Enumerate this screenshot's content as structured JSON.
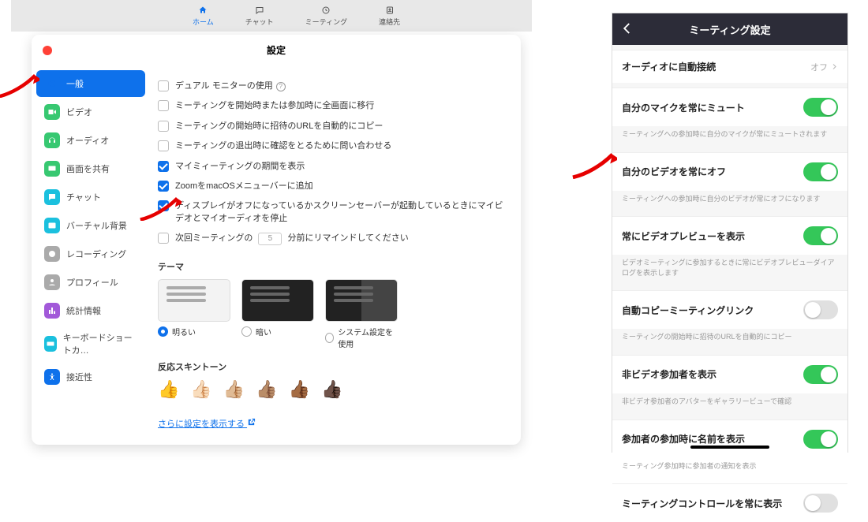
{
  "topTabs": [
    {
      "key": "home",
      "label": "ホーム",
      "active": true
    },
    {
      "key": "chat",
      "label": "チャット",
      "active": false
    },
    {
      "key": "meeting",
      "label": "ミーティング",
      "active": false
    },
    {
      "key": "contacts",
      "label": "連絡先",
      "active": false
    }
  ],
  "window": {
    "title": "設定"
  },
  "sidebar": [
    {
      "key": "general",
      "label": "一般",
      "icon": "gear",
      "color": "#0e71eb",
      "active": true
    },
    {
      "key": "video",
      "label": "ビデオ",
      "icon": "video",
      "color": "#37c871"
    },
    {
      "key": "audio",
      "label": "オーディオ",
      "icon": "headset",
      "color": "#37c871"
    },
    {
      "key": "share",
      "label": "画面を共有",
      "icon": "share",
      "color": "#37c871"
    },
    {
      "key": "chat",
      "label": "チャット",
      "icon": "chat",
      "color": "#1bc0de"
    },
    {
      "key": "vbg",
      "label": "バーチャル背景",
      "icon": "bg",
      "color": "#1bc0de"
    },
    {
      "key": "recording",
      "label": "レコーディング",
      "icon": "rec",
      "color": "#aaa"
    },
    {
      "key": "profile",
      "label": "プロフィール",
      "icon": "profile",
      "color": "#aaa"
    },
    {
      "key": "stats",
      "label": "統計情報",
      "icon": "stats",
      "color": "#a259d9"
    },
    {
      "key": "shortcut",
      "label": "キーボードショートカ…",
      "icon": "kb",
      "color": "#1bc0de"
    },
    {
      "key": "access",
      "label": "接近性",
      "icon": "access",
      "color": "#0e71eb"
    }
  ],
  "options": [
    {
      "label": "デュアル モニターの使用",
      "checked": false,
      "help": true
    },
    {
      "label": "ミーティングを開始時または参加時に全画面に移行",
      "checked": false
    },
    {
      "label": "ミーティングの開始時に招待のURLを自動的にコピー",
      "checked": false
    },
    {
      "label": "ミーティングの退出時に確認をとるために問い合わせる",
      "checked": false
    },
    {
      "label": "マイミィーティングの期間を表示",
      "checked": true
    },
    {
      "label": "ZoomをmacOSメニューバーに追加",
      "checked": true
    },
    {
      "label": "ディスプレイがオフになっているかスクリーンセーバーが起動しているときにマイビデオとマイオーディオを停止",
      "checked": true
    }
  ],
  "remind": {
    "prefix": "次回ミーティングの",
    "value": "5",
    "suffix": "分前にリマインドしてください",
    "checked": false
  },
  "themeHeading": "テーマ",
  "themes": [
    {
      "key": "light",
      "label": "明るい",
      "selected": true
    },
    {
      "key": "dark",
      "label": "暗い",
      "selected": false
    },
    {
      "key": "system",
      "label": "システム設定を使用",
      "selected": false
    }
  ],
  "skinHeading": "反応スキントーン",
  "skins": [
    "👍",
    "👍🏻",
    "👍🏼",
    "👍🏽",
    "👍🏾",
    "👍🏿"
  ],
  "moreLink": "さらに設定を表示する",
  "phone": {
    "title": "ミーティング設定",
    "rows": [
      {
        "key": "audio_connect",
        "label": "オーディオに自動接続",
        "type": "value",
        "value": "オフ"
      },
      {
        "key": "mic_mute",
        "label": "自分のマイクを常にミュート",
        "type": "toggle",
        "on": true,
        "desc": "ミーティングへの参加時に自分のマイクが常にミュートされます"
      },
      {
        "key": "video_off",
        "label": "自分のビデオを常にオフ",
        "type": "toggle",
        "on": true,
        "desc": "ミーティングへの参加時に自分のビデオが常にオフになります"
      },
      {
        "key": "video_preview",
        "label": "常にビデオプレビューを表示",
        "type": "toggle",
        "on": true,
        "desc": "ビデオミーティングに参加するときに常にビデオプレビューダイアログを表示します"
      },
      {
        "key": "copy_link",
        "label": "自動コピーミーティングリンク",
        "type": "toggle",
        "on": false,
        "desc": "ミーティングの開始時に招待のURLを自動的にコピー"
      },
      {
        "key": "nonvideo",
        "label": "非ビデオ参加者を表示",
        "type": "toggle",
        "on": true,
        "desc": "非ビデオ参加者のアバターをギャラリービューで確認"
      },
      {
        "key": "show_name",
        "label": "参加者の参加時に名前を表示",
        "type": "toggle",
        "on": true,
        "desc": "ミーティング参加時に参加者の通知を表示"
      },
      {
        "key": "controls",
        "label": "ミーティングコントロールを常に表示",
        "type": "toggle",
        "on": false
      }
    ]
  }
}
